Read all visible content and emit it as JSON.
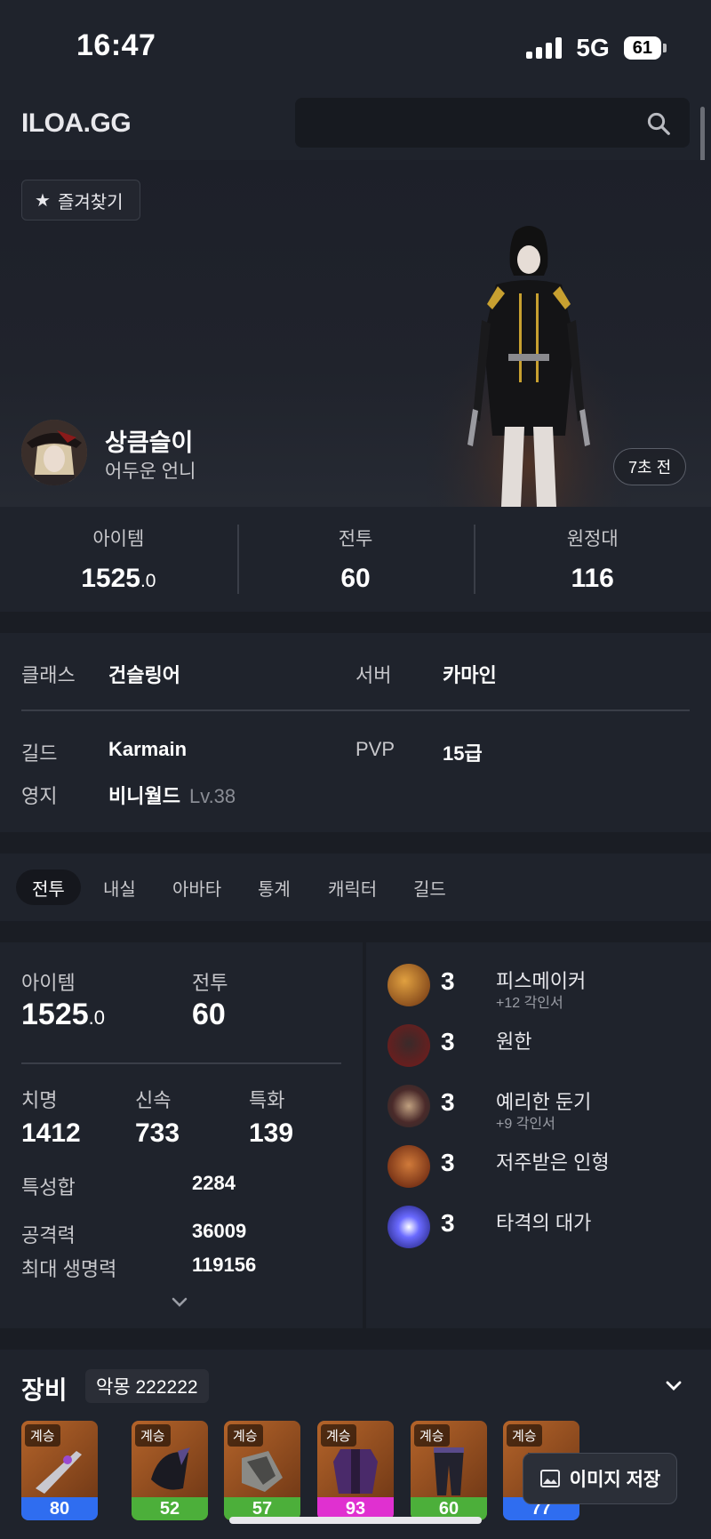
{
  "status_bar": {
    "time": "16:47",
    "network": "5G",
    "battery": "61"
  },
  "header": {
    "logo": "ILOA.GG",
    "search_placeholder": ""
  },
  "profile": {
    "favorite_label": "즐겨찾기",
    "name": "상큼슬이",
    "title": "어두운 언니",
    "updated": "7초 전"
  },
  "summary": [
    {
      "label": "아이템",
      "value": "1525",
      "decimal": ".0"
    },
    {
      "label": "전투",
      "value": "60",
      "decimal": ""
    },
    {
      "label": "원정대",
      "value": "116",
      "decimal": ""
    }
  ],
  "info": {
    "class_label": "클래스",
    "class_value": "건슬링어",
    "server_label": "서버",
    "server_value": "카마인",
    "guild_label": "길드",
    "guild_value": "Karmain",
    "pvp_label": "PVP",
    "pvp_value": "15급",
    "estate_label": "영지",
    "estate_value": "비니월드",
    "estate_level": "Lv.38"
  },
  "tabs": [
    "전투",
    "내실",
    "아바타",
    "통계",
    "캐릭터",
    "길드"
  ],
  "combat": {
    "item_label": "아이템",
    "item_value": "1525",
    "item_decimal": ".0",
    "battle_label": "전투",
    "battle_value": "60",
    "crit_label": "치명",
    "crit_value": "1412",
    "swift_label": "신속",
    "swift_value": "733",
    "spec_label": "특화",
    "spec_value": "139",
    "stat_total_label": "특성합",
    "stat_total_value": "2284",
    "attack_label": "공격력",
    "attack_value": "36009",
    "hp_label": "최대 생명력",
    "hp_value": "119156"
  },
  "engravings": [
    {
      "level": "3",
      "name": "피스메이커",
      "sub": "+12 각인서",
      "color": "#c0742a"
    },
    {
      "level": "3",
      "name": "원한",
      "sub": "",
      "color": "#7a2a2a"
    },
    {
      "level": "3",
      "name": "예리한 둔기",
      "sub": "+9 각인서",
      "color": "#6a4a3a"
    },
    {
      "level": "3",
      "name": "저주받은 인형",
      "sub": "",
      "color": "#8a3a1a"
    },
    {
      "level": "3",
      "name": "타격의 대가",
      "sub": "",
      "color": "#5a5adc"
    }
  ],
  "equipment": {
    "title": "장비",
    "set_badge": "악몽 222222",
    "slots": [
      {
        "tag": "계승",
        "quality": "80",
        "quality_color": "#2f6df0"
      },
      {
        "tag": "계승",
        "quality": "52",
        "quality_color": "#4caf3a"
      },
      {
        "tag": "계승",
        "quality": "57",
        "quality_color": "#4caf3a"
      },
      {
        "tag": "계승",
        "quality": "93",
        "quality_color": "#e030d0"
      },
      {
        "tag": "계승",
        "quality": "60",
        "quality_color": "#4caf3a"
      },
      {
        "tag": "계승",
        "quality": "77",
        "quality_color": "#2f6df0"
      }
    ],
    "save_image_label": "이미지 저장"
  }
}
